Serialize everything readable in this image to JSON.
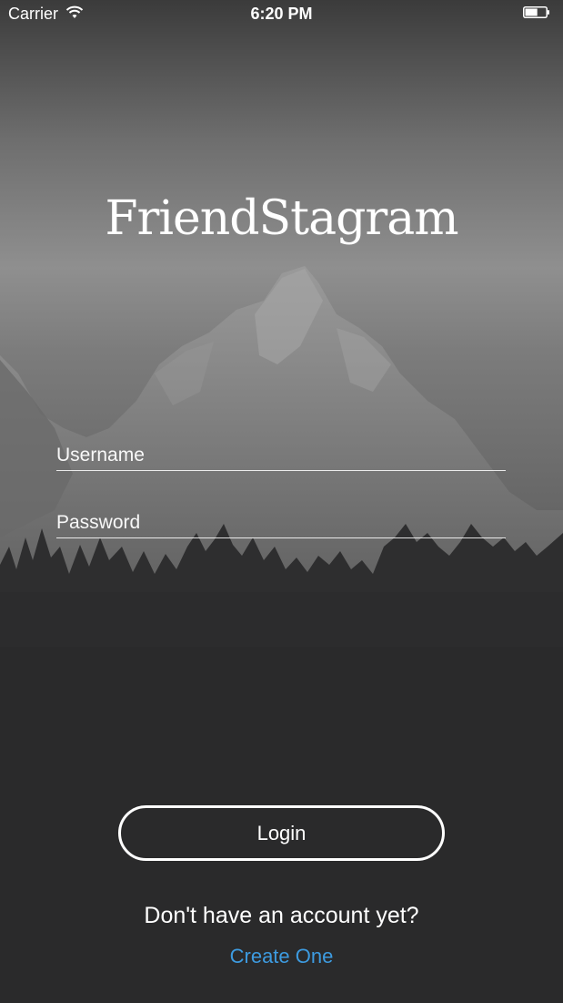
{
  "status_bar": {
    "carrier": "Carrier",
    "time": "6:20 PM",
    "icons": {
      "wifi": "wifi-icon",
      "battery": "battery-icon"
    },
    "battery_level": 0.6
  },
  "app": {
    "title": "FriendStagram"
  },
  "form": {
    "username_placeholder": "Username",
    "username_value": "",
    "password_placeholder": "Password",
    "password_value": ""
  },
  "actions": {
    "login_label": "Login",
    "signup_prompt": "Don't have an account yet?",
    "create_label": "Create One"
  },
  "colors": {
    "background": "#2a2a2b",
    "text": "#ffffff",
    "link": "#3d9be0"
  }
}
